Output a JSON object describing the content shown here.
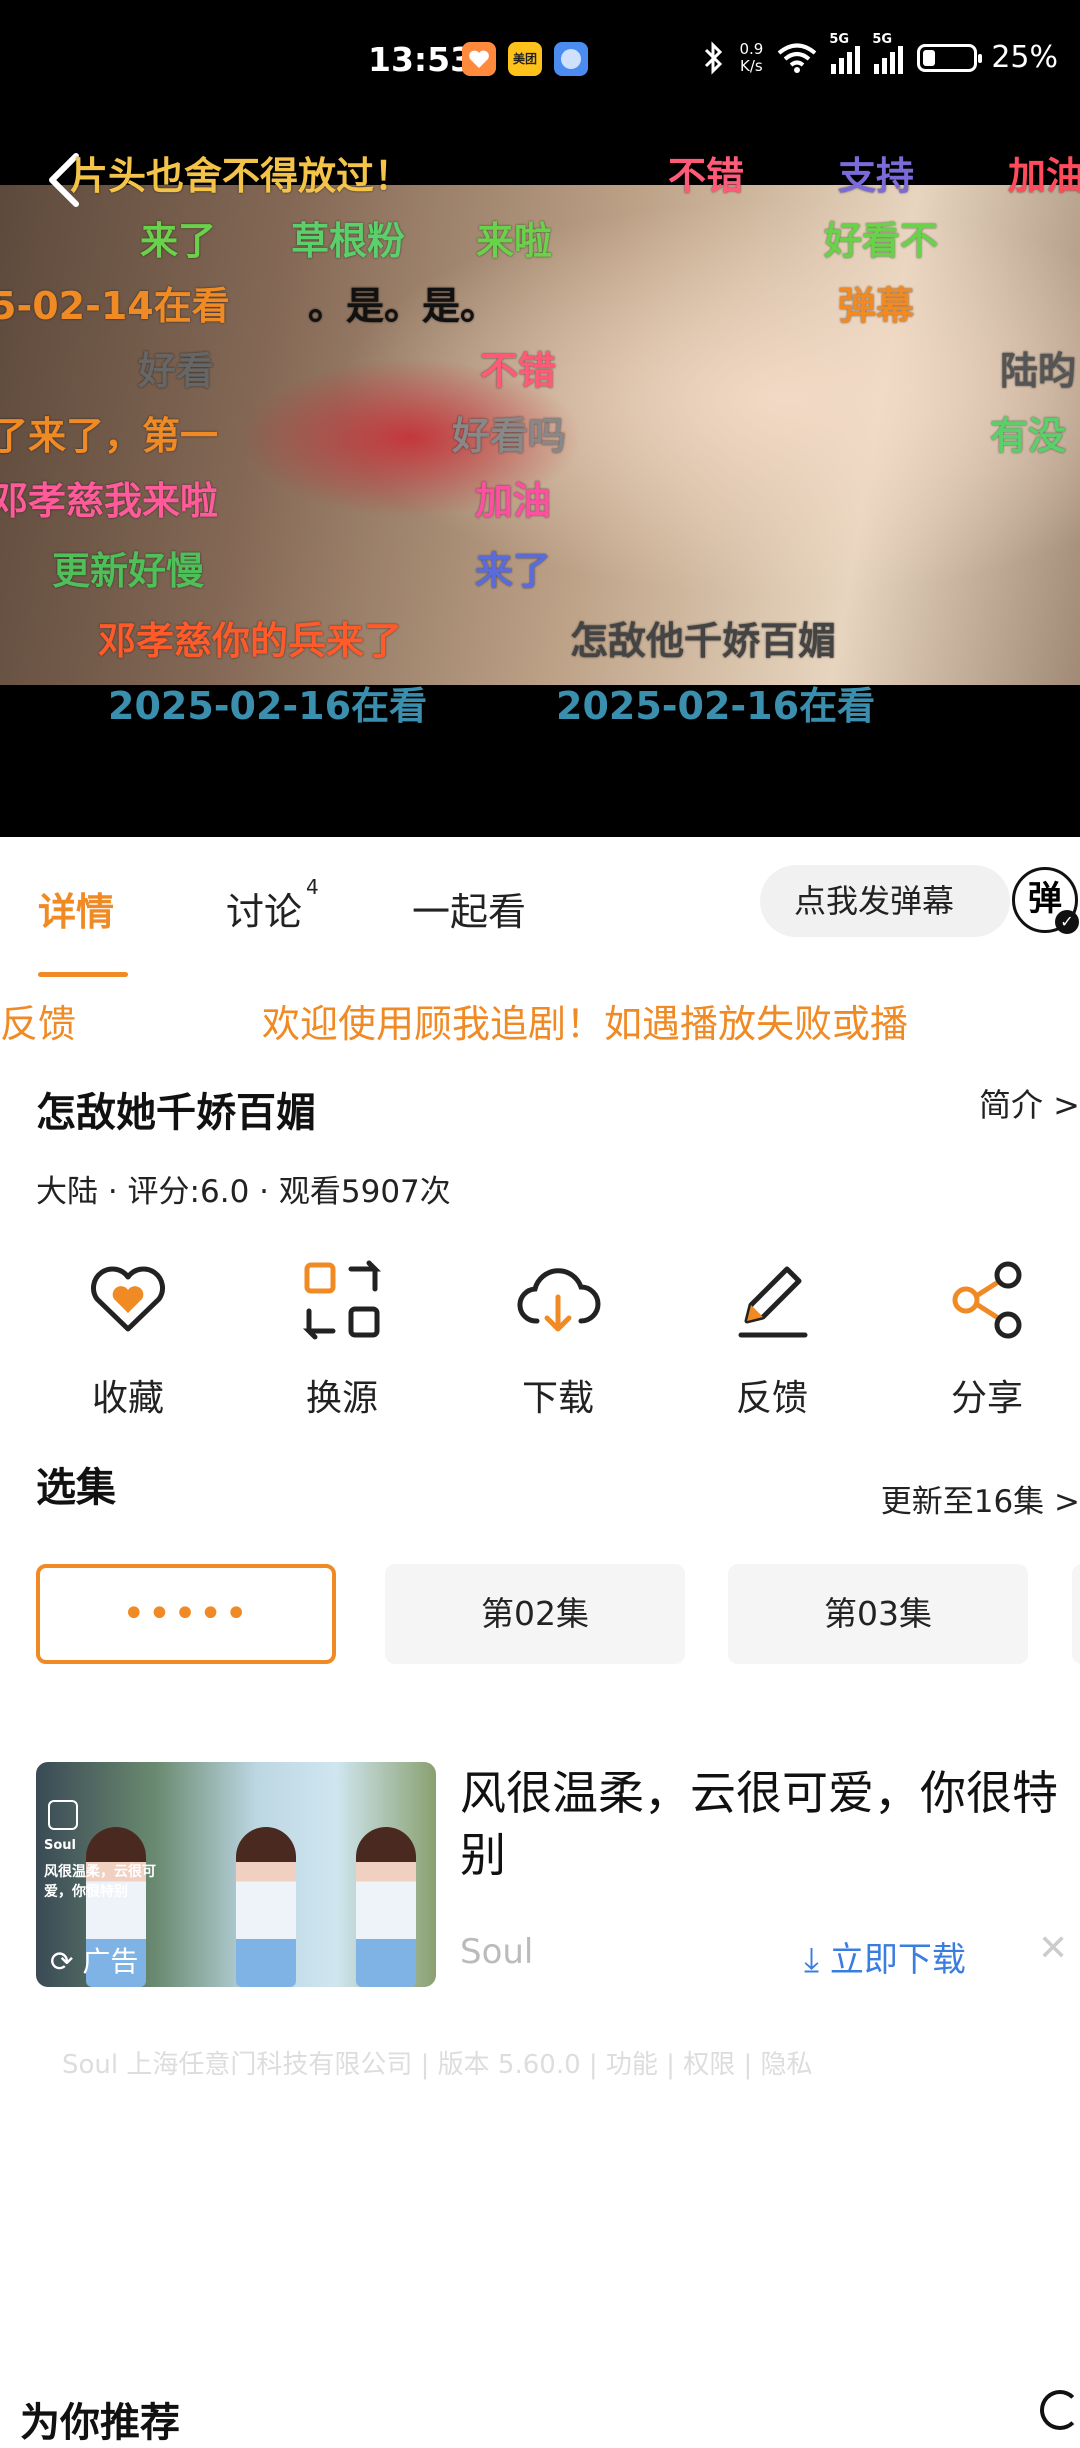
{
  "status_bar": {
    "time": "13:53",
    "app_icons": [
      {
        "icon": "heart-app-icon",
        "color": "#ff8a3d"
      },
      {
        "icon": "meituan-icon",
        "label": "美团",
        "color": "#ffc21a"
      },
      {
        "icon": "ball-app-icon",
        "color": "#4a8cf0"
      }
    ],
    "net_speed_value": "0.9",
    "net_speed_unit": "K/s",
    "signal_1": "5G",
    "signal_2": "5G",
    "battery": "25%",
    "battery_level": 0.25
  },
  "video": {
    "back_icon": "chevron-left-icon",
    "danmaku": [
      {
        "text": "片头也舍不得放过！",
        "color": "#f3c34a"
      },
      {
        "text": "不错",
        "color": "#ff5a78"
      },
      {
        "text": "支持",
        "color": "#7a6bd9"
      },
      {
        "text": "加油",
        "color": "#ff4b5c"
      },
      {
        "text": "来了",
        "color": "#6ad14a"
      },
      {
        "text": "草根粉",
        "color": "#5bcf6a"
      },
      {
        "text": "来啦",
        "color": "#6ad14a"
      },
      {
        "text": "好看不",
        "color": "#6ad14a"
      },
      {
        "text": "5-02-14在看",
        "color": "#f08a24"
      },
      {
        "text": "。是。是。",
        "color": "#111111"
      },
      {
        "text": "弹幕",
        "color": "#f08a24"
      },
      {
        "text": "好看",
        "color": "#666666"
      },
      {
        "text": "不错",
        "color": "#ff5a78"
      },
      {
        "text": "陆昀",
        "color": "#555555"
      },
      {
        "text": "了来了，第一",
        "color": "#f08a24"
      },
      {
        "text": "好看吗",
        "color": "#888888"
      },
      {
        "text": "有没",
        "color": "#5bcf6a"
      },
      {
        "text": "邓孝慈我来啦",
        "color": "#ff5a9a"
      },
      {
        "text": "加油",
        "color": "#ff4fa0"
      },
      {
        "text": "更新好慢",
        "color": "#4fbf5a"
      },
      {
        "text": "来了",
        "color": "#5a6bdc"
      },
      {
        "text": "邓孝慈你的兵来了",
        "color": "#ff5a2a"
      },
      {
        "text": "怎敌他千娇百媚",
        "color": "#444444"
      },
      {
        "text": "2025-02-16在看",
        "color": "#3a8fae"
      },
      {
        "text": "2025-02-16在看",
        "color": "#3a8fae"
      }
    ]
  },
  "tabs": {
    "items": [
      {
        "label": "详情",
        "badge": ""
      },
      {
        "label": "讨论",
        "badge": "4"
      },
      {
        "label": "一起看",
        "badge": ""
      }
    ],
    "active_index": 0,
    "danmu_placeholder": "点我发弹幕",
    "danmu_toggle": "弹",
    "accent_color": "#f08a24"
  },
  "notice": {
    "left_fragment": "或反馈",
    "text": "欢迎使用顾我追剧！如遇播放失败或播"
  },
  "detail": {
    "title": "怎敌她千娇百媚",
    "intro_link": "简介 >",
    "meta": "大陆 · 评分:6.0 · 观看5907次"
  },
  "actions": [
    {
      "label": "收藏",
      "icon": "heart-icon"
    },
    {
      "label": "换源",
      "icon": "switch-source-icon"
    },
    {
      "label": "下载",
      "icon": "cloud-download-icon"
    },
    {
      "label": "反馈",
      "icon": "pen-feedback-icon"
    },
    {
      "label": "分享",
      "icon": "share-icon"
    }
  ],
  "episodes": {
    "section_title": "选集",
    "update_text": "更新至16集 >",
    "items": [
      {
        "label": "•••••",
        "playing": true
      },
      {
        "label": "第02集",
        "playing": false
      },
      {
        "label": "第03集",
        "playing": false
      }
    ]
  },
  "ad": {
    "headline": "风很温柔，云很可爱，你很特别",
    "brand": "Soul",
    "download_label": "立即下载",
    "ad_mark": "广告",
    "thumb_text": "风很温柔，云很可爱，你很特别",
    "thumb_logo_text": "Soul",
    "close_icon": "close-icon",
    "footer": "Soul 上海任意门科技有限公司 | 版本 5.60.0 | 功能 | 权限 | 隐私"
  },
  "recommend": {
    "title": "为你推荐"
  }
}
